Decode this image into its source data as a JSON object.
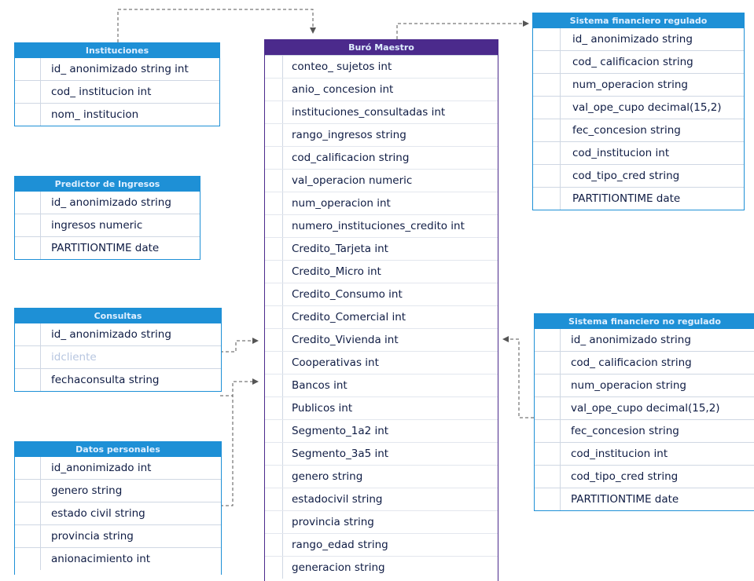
{
  "entities": {
    "instituciones": {
      "title": "Instituciones",
      "fields": [
        "id_ anonimizado string int",
        "cod_ institucion int",
        "nom_ institucion"
      ]
    },
    "ingresos": {
      "title": "Predictor de Ingresos",
      "fields": [
        "id_ anonimizado string",
        "ingresos numeric",
        "PARTITIONTIME date"
      ]
    },
    "consultas": {
      "title": "Consultas",
      "fields": [
        "id_ anonimizado string",
        "idcliente",
        "fechaconsulta string"
      ]
    },
    "otros": {
      "title": "Datos personales",
      "fields": [
        "id_anonimizado int",
        "genero string",
        "estado civil string",
        "provincia string",
        "anionacimiento int"
      ]
    },
    "buro": {
      "title": "Buró Maestro",
      "fields": [
        "conteo_ sujetos int",
        "anio_ concesion int",
        "instituciones_consultadas int",
        "rango_ingresos string",
        "cod_calificacion string",
        "val_operacion numeric",
        "num_operacion int",
        "numero_instituciones_credito int",
        "Credito_Tarjeta int",
        "Credito_Micro int",
        "Credito_Consumo int",
        "Credito_Comercial int",
        "Credito_Vivienda int",
        "Cooperativas int",
        "Bancos int",
        "Publicos int",
        "Segmento_1a2 int",
        "Segmento_3a5 int",
        "genero string",
        "estadocivil string",
        "provincia string",
        "rango_edad string",
        "generacion string"
      ]
    },
    "regulado": {
      "title": "Sistema financiero regulado",
      "fields": [
        "id_ anonimizado string",
        "cod_ calificacion string",
        "num_operacion string",
        "val_ope_cupo decimal(15,2)",
        "fec_concesion string",
        "cod_institucion int",
        "cod_tipo_cred string",
        "PARTITIONTIME date"
      ]
    },
    "no_regulado": {
      "title": "Sistema financiero no regulado",
      "fields": [
        "id_ anonimizado string",
        "cod_ calificacion string",
        "num_operacion string",
        "val_ope_cupo decimal(15,2)",
        "fec_concesion string",
        "cod_institucion int",
        "cod_tipo_cred string",
        "PARTITIONTIME date"
      ]
    }
  },
  "colors": {
    "table_header": "#1e90d6",
    "main_table_header": "#4b2a8c",
    "text": "#0f1c44",
    "connector": "#555555"
  }
}
